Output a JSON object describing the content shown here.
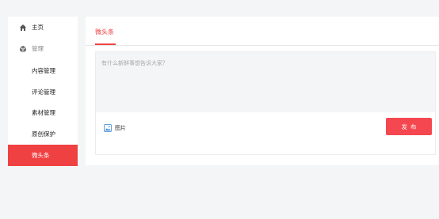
{
  "sidebar": {
    "items": [
      {
        "label": "主页",
        "icon": "home-icon"
      },
      {
        "label": "管理",
        "icon": "cube-icon"
      },
      {
        "label": "内容管理"
      },
      {
        "label": "评论管理"
      },
      {
        "label": "素材管理"
      },
      {
        "label": "原创保护"
      },
      {
        "label": "微头条"
      }
    ]
  },
  "main": {
    "tabs": [
      {
        "label": "微头条"
      }
    ],
    "composer": {
      "placeholder": "有什么新鲜事想告诉大家？",
      "value": "",
      "image_label": "图片",
      "publish_label": "发布"
    }
  },
  "colors": {
    "accent": "#f04142",
    "publish": "#f5474f",
    "background": "#f4f5f6",
    "icon_blue": "#4a90d9"
  }
}
